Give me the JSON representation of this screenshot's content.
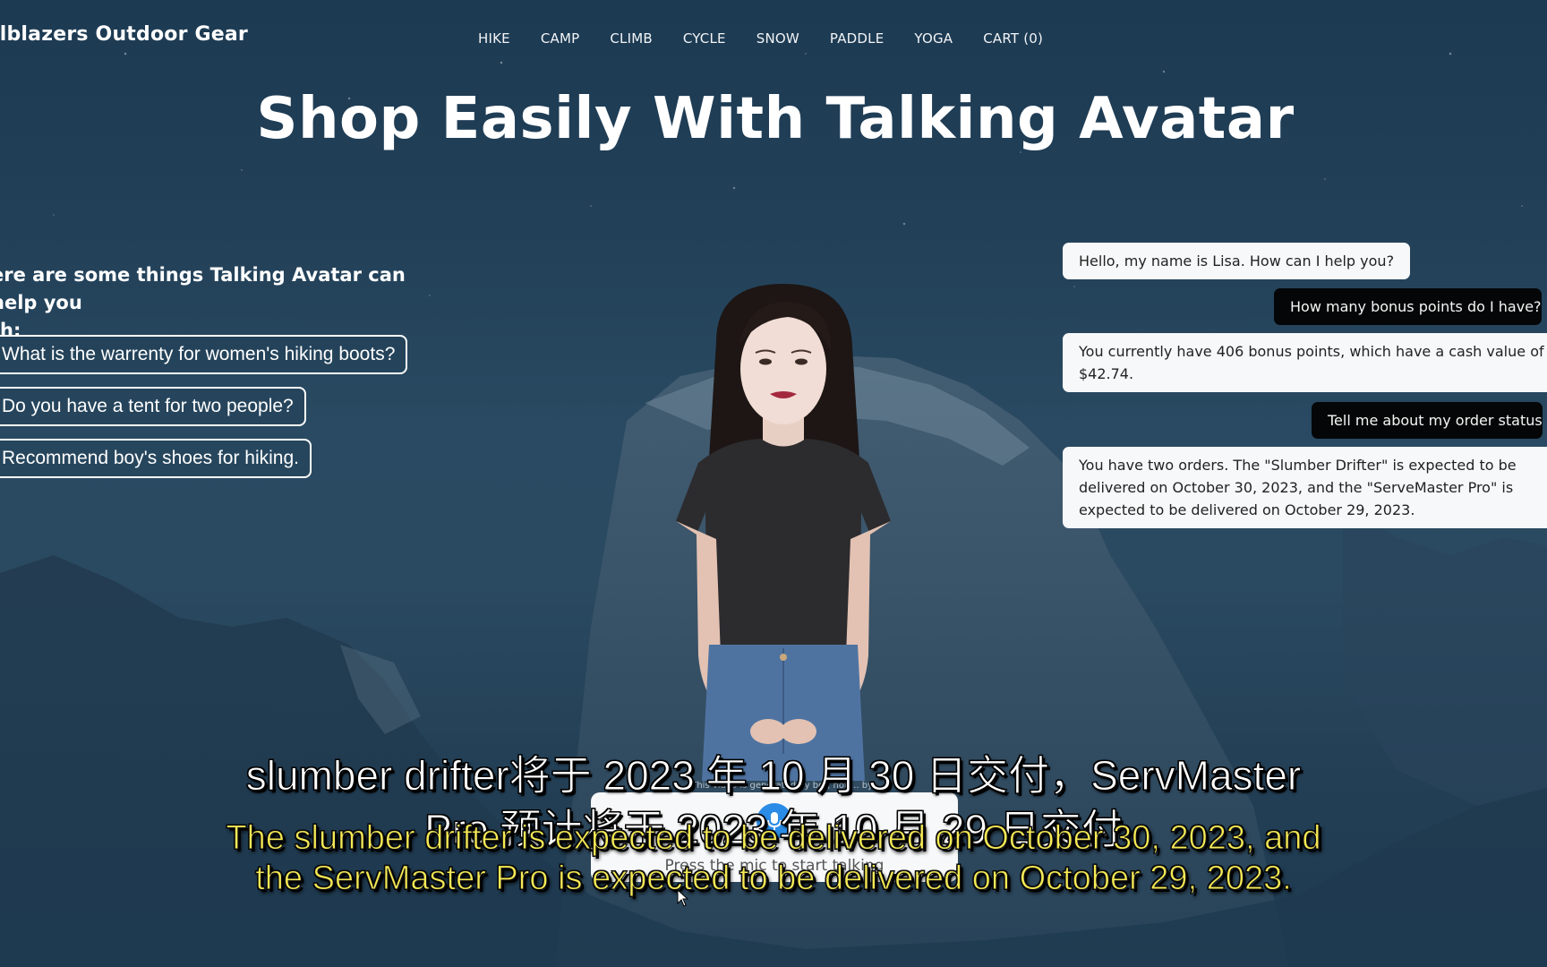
{
  "header": {
    "brand": "ilblazers Outdoor Gear",
    "nav": [
      "HIKE",
      "CAMP",
      "CLIMB",
      "CYCLE",
      "SNOW",
      "PADDLE",
      "YOGA",
      "CART (0)"
    ]
  },
  "hero": {
    "title": "Shop Easily With Talking Avatar"
  },
  "suggestions": {
    "intro": "ere are some things Talking Avatar can help you th:",
    "intro_line1": "ere are some things Talking Avatar can help you",
    "intro_line2": "th:",
    "items": [
      "What is the warrenty for women's hiking boots?",
      "Do you have a tent for two people?",
      "Recommend boy's shoes for hiking."
    ]
  },
  "chat": {
    "messages": [
      {
        "role": "bot",
        "text": "Hello, my name is Lisa. How can I help you?"
      },
      {
        "role": "user",
        "text": "How many bonus points do I have?"
      },
      {
        "role": "bot",
        "text": "You currently have 406 bonus points, which have a cash value of $42.74."
      },
      {
        "role": "user",
        "text": "Tell me about my order status"
      },
      {
        "role": "bot",
        "text": "You have two orders. The \"Slumber Drifter\" is expected to be delivered on October 30, 2023, and the \"ServeMaster Pro\" is expected to be delivered on October 29, 2023."
      }
    ]
  },
  "mic": {
    "hint": "Press the mic to start talking",
    "disclaimer": "This video is generated by bot, not ... by ..."
  },
  "subtitles": {
    "zh_line1": "slumber drifter将于 2023 年 10 月 30 日交付，ServMaster",
    "zh_line2": "Pro 预计将于 2023 年 10 月 29 日交付",
    "en_line1": "The slumber drifter is expected to be delivered on October 30, 2023, and",
    "en_line2": "the ServMaster Pro is expected to be delivered on October 29, 2023."
  },
  "colors": {
    "background": "#233f55",
    "bot_bubble": "#f7f8f9",
    "user_bubble": "#050607",
    "subtitle_en": "#f5ea55",
    "mic_accent": "#2a8ce6"
  }
}
